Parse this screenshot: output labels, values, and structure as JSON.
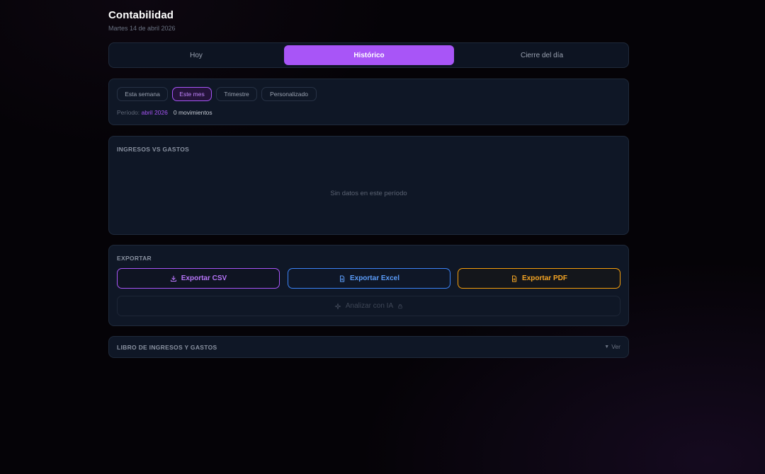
{
  "header": {
    "title": "Contabilidad",
    "date": "Martes 14 de abril 2026"
  },
  "tabs": [
    {
      "label": "Hoy",
      "active": false
    },
    {
      "label": "Histórico",
      "active": true
    },
    {
      "label": "Cierre del día",
      "active": false
    }
  ],
  "filters": {
    "options": [
      "Esta semana",
      "Este mes",
      "Trimestre",
      "Personalizado"
    ],
    "selected": "Este mes",
    "periodo_label": "Período:",
    "periodo_value": "abril 2026",
    "movimientos": "0 movimientos"
  },
  "chart_card": {
    "title": "INGRESOS VS GASTOS",
    "empty_text": "Sin datos en este período"
  },
  "export": {
    "title": "EXPORTAR",
    "csv_label": "Exportar CSV",
    "excel_label": "Exportar Excel",
    "pdf_label": "Exportar PDF",
    "ai_label": "Analizar con IA",
    "icons": {
      "csv": "download-icon",
      "excel": "document-icon",
      "pdf": "document-icon",
      "ai": "sparkle-icon",
      "ai_lock": "lock-icon"
    }
  },
  "libro": {
    "title": "LIBRO DE INGRESOS Y GASTOS",
    "toggle_label": "Ver"
  },
  "colors": {
    "accent": "#a855f7",
    "excel": "#3b82f6",
    "pdf": "#f59e0b"
  }
}
